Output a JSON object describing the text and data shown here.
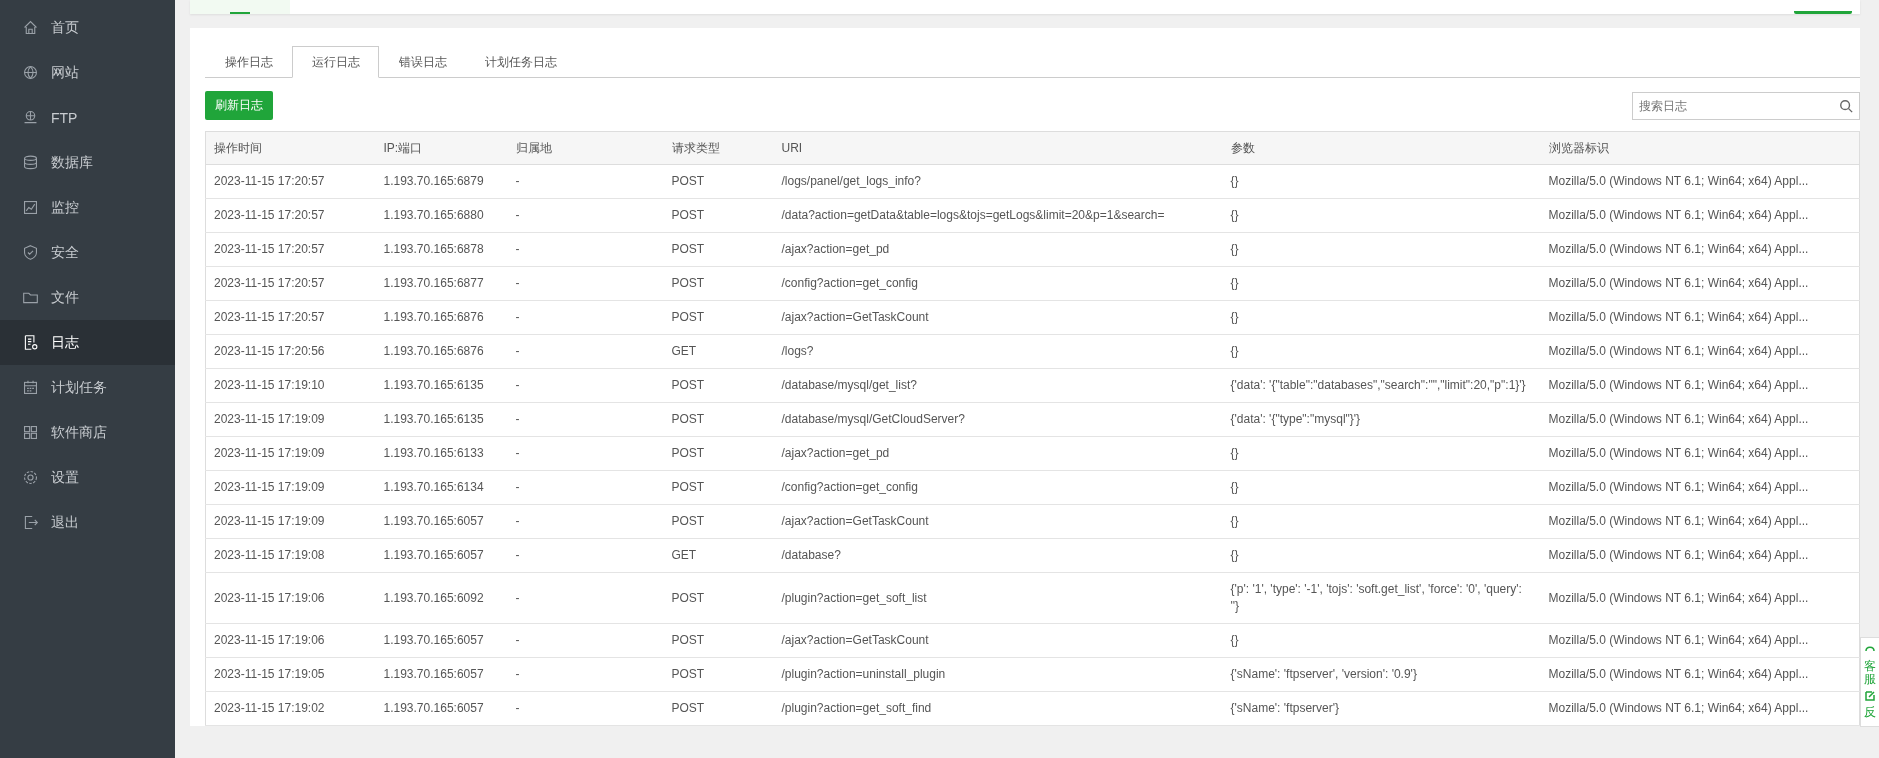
{
  "sidebar": {
    "items": [
      {
        "label": "首页",
        "selected": false
      },
      {
        "label": "网站",
        "selected": false
      },
      {
        "label": "FTP",
        "selected": false
      },
      {
        "label": "数据库",
        "selected": false
      },
      {
        "label": "监控",
        "selected": false
      },
      {
        "label": "安全",
        "selected": false
      },
      {
        "label": "文件",
        "selected": false
      },
      {
        "label": "日志",
        "selected": true
      },
      {
        "label": "计划任务",
        "selected": false
      },
      {
        "label": "软件商店",
        "selected": false
      },
      {
        "label": "设置",
        "selected": false
      },
      {
        "label": "退出",
        "selected": false
      }
    ]
  },
  "tabs": [
    {
      "label": "操作日志",
      "selected": false
    },
    {
      "label": "运行日志",
      "selected": true
    },
    {
      "label": "错误日志",
      "selected": false
    },
    {
      "label": "计划任务日志",
      "selected": false
    }
  ],
  "refresh_button": "刷新日志",
  "search": {
    "placeholder": "搜索日志"
  },
  "table": {
    "columns": [
      "操作时间",
      "IP:端口",
      "归属地",
      "请求类型",
      "URI",
      "参数",
      "浏览器标识"
    ],
    "rows": [
      [
        "2023-11-15 17:20:57",
        "1.193.70.165:6879",
        "-",
        "POST",
        "/logs/panel/get_logs_info?",
        "{}",
        "Mozilla/5.0 (Windows NT 6.1; Win64; x64) Appl..."
      ],
      [
        "2023-11-15 17:20:57",
        "1.193.70.165:6880",
        "-",
        "POST",
        "/data?action=getData&table=logs&tojs=getLogs&limit=20&p=1&search=",
        "{}",
        "Mozilla/5.0 (Windows NT 6.1; Win64; x64) Appl..."
      ],
      [
        "2023-11-15 17:20:57",
        "1.193.70.165:6878",
        "-",
        "POST",
        "/ajax?action=get_pd",
        "{}",
        "Mozilla/5.0 (Windows NT 6.1; Win64; x64) Appl..."
      ],
      [
        "2023-11-15 17:20:57",
        "1.193.70.165:6877",
        "-",
        "POST",
        "/config?action=get_config",
        "{}",
        "Mozilla/5.0 (Windows NT 6.1; Win64; x64) Appl..."
      ],
      [
        "2023-11-15 17:20:57",
        "1.193.70.165:6876",
        "-",
        "POST",
        "/ajax?action=GetTaskCount",
        "{}",
        "Mozilla/5.0 (Windows NT 6.1; Win64; x64) Appl..."
      ],
      [
        "2023-11-15 17:20:56",
        "1.193.70.165:6876",
        "-",
        "GET",
        "/logs?",
        "{}",
        "Mozilla/5.0 (Windows NT 6.1; Win64; x64) Appl..."
      ],
      [
        "2023-11-15 17:19:10",
        "1.193.70.165:6135",
        "-",
        "POST",
        "/database/mysql/get_list?",
        "{'data': '{\"table\":\"databases\",\"search\":\"\",\"limit\":20,\"p\":1}'}",
        "Mozilla/5.0 (Windows NT 6.1; Win64; x64) Appl..."
      ],
      [
        "2023-11-15 17:19:09",
        "1.193.70.165:6135",
        "-",
        "POST",
        "/database/mysql/GetCloudServer?",
        "{'data': '{\"type\":\"mysql\"}'}",
        "Mozilla/5.0 (Windows NT 6.1; Win64; x64) Appl..."
      ],
      [
        "2023-11-15 17:19:09",
        "1.193.70.165:6133",
        "-",
        "POST",
        "/ajax?action=get_pd",
        "{}",
        "Mozilla/5.0 (Windows NT 6.1; Win64; x64) Appl..."
      ],
      [
        "2023-11-15 17:19:09",
        "1.193.70.165:6134",
        "-",
        "POST",
        "/config?action=get_config",
        "{}",
        "Mozilla/5.0 (Windows NT 6.1; Win64; x64) Appl..."
      ],
      [
        "2023-11-15 17:19:09",
        "1.193.70.165:6057",
        "-",
        "POST",
        "/ajax?action=GetTaskCount",
        "{}",
        "Mozilla/5.0 (Windows NT 6.1; Win64; x64) Appl..."
      ],
      [
        "2023-11-15 17:19:08",
        "1.193.70.165:6057",
        "-",
        "GET",
        "/database?",
        "{}",
        "Mozilla/5.0 (Windows NT 6.1; Win64; x64) Appl..."
      ],
      [
        "2023-11-15 17:19:06",
        "1.193.70.165:6092",
        "-",
        "POST",
        "/plugin?action=get_soft_list",
        "{'p': '1', 'type': '-1', 'tojs': 'soft.get_list', 'force': '0', 'query': ''}",
        "Mozilla/5.0 (Windows NT 6.1; Win64; x64) Appl..."
      ],
      [
        "2023-11-15 17:19:06",
        "1.193.70.165:6057",
        "-",
        "POST",
        "/ajax?action=GetTaskCount",
        "{}",
        "Mozilla/5.0 (Windows NT 6.1; Win64; x64) Appl..."
      ],
      [
        "2023-11-15 17:19:05",
        "1.193.70.165:6057",
        "-",
        "POST",
        "/plugin?action=uninstall_plugin",
        "{'sName': 'ftpserver', 'version': '0.9'}",
        "Mozilla/5.0 (Windows NT 6.1; Win64; x64) Appl..."
      ],
      [
        "2023-11-15 17:19:02",
        "1.193.70.165:6057",
        "-",
        "POST",
        "/plugin?action=get_soft_find",
        "{'sName': 'ftpserver'}",
        "Mozilla/5.0 (Windows NT 6.1; Win64; x64) Appl..."
      ]
    ]
  },
  "float_panel": {
    "items": [
      "客服",
      "反"
    ]
  }
}
